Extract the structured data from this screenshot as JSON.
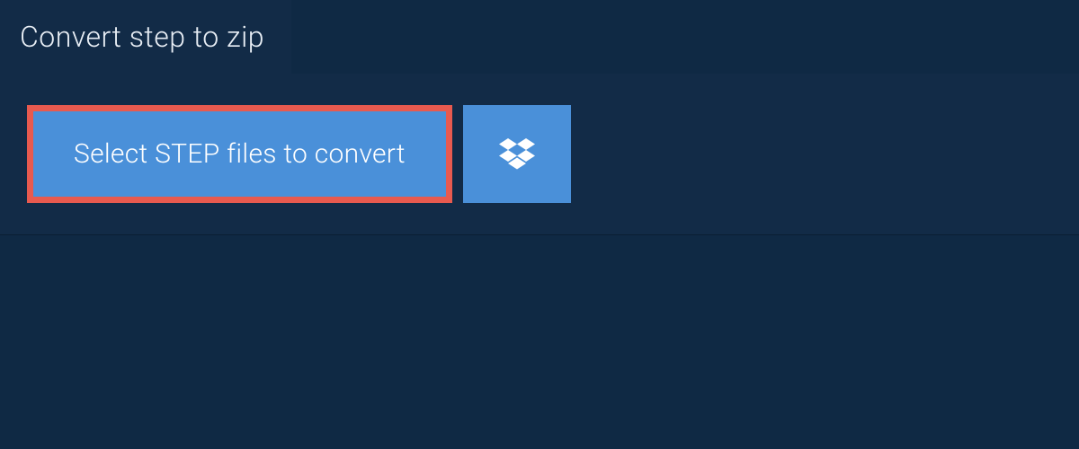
{
  "tab": {
    "title": "Convert step to zip"
  },
  "main": {
    "select_button_label": "Select STEP files to convert"
  }
}
